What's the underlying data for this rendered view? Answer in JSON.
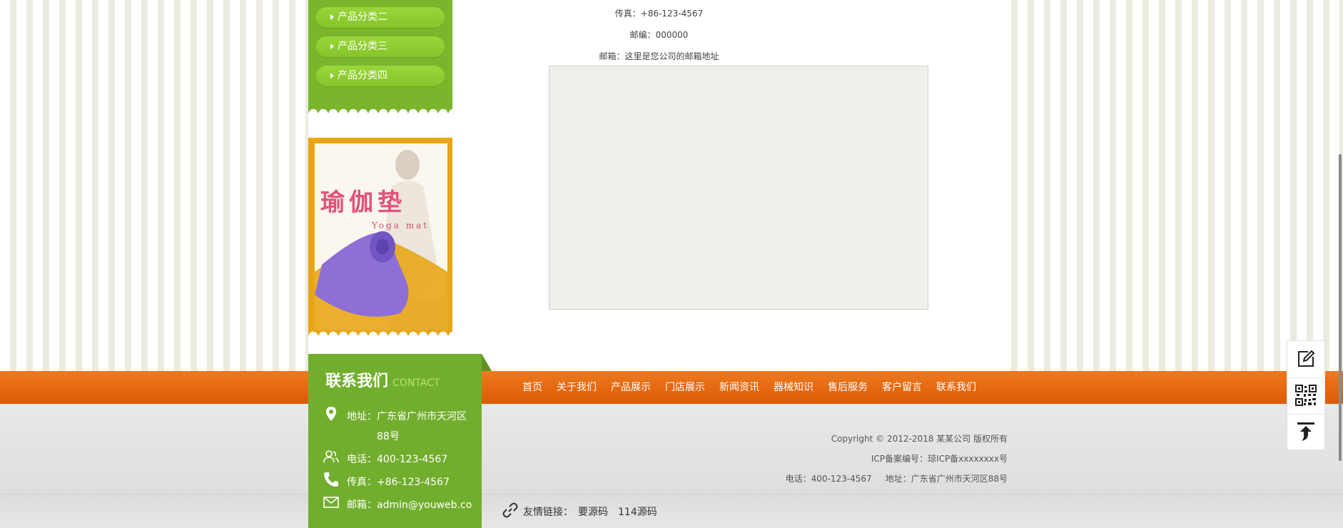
{
  "sidebar": {
    "categories": [
      "产品分类二",
      "产品分类三",
      "产品分类四"
    ],
    "ad": {
      "title": "瑜伽垫",
      "subtitle": "Yoga mat"
    }
  },
  "contact_info": {
    "fax": "传真：+86-123-4567",
    "zip": "邮编：000000",
    "email": "邮箱：这里是您公司的邮箱地址"
  },
  "nav": {
    "items": [
      "首页",
      "关于我们",
      "产品展示",
      "门店展示",
      "新闻资讯",
      "器械知识",
      "售后服务",
      "客户留言",
      "联系我们"
    ]
  },
  "contact_box": {
    "title": "联系我们",
    "title_en": "CONTACT",
    "address_label": "地址：",
    "address_value_1": "广东省广州市天河区",
    "address_value_2": "88号",
    "phone_label": "电话：",
    "phone_value": "400-123-4567",
    "fax_label": "传真：",
    "fax_value": "+86-123-4567",
    "email_label": "邮箱：",
    "email_value": "admin@youweb.co"
  },
  "footer": {
    "copyright": "Copyright © 2012-2018 某某公司 版权所有",
    "icp": "ICP备案编号：琼ICP备xxxxxxxx号",
    "phone_addr": "电话：400-123-4567     地址：广东省广州市天河区88号"
  },
  "links": {
    "label": "友情链接：",
    "items": [
      "要源码",
      "114源码"
    ]
  },
  "colors": {
    "green": "#7ab52c",
    "orange": "#e56a10",
    "yellow": "#e8a617"
  },
  "tools": [
    "edit-icon",
    "qrcode-icon",
    "back-to-top-icon"
  ]
}
